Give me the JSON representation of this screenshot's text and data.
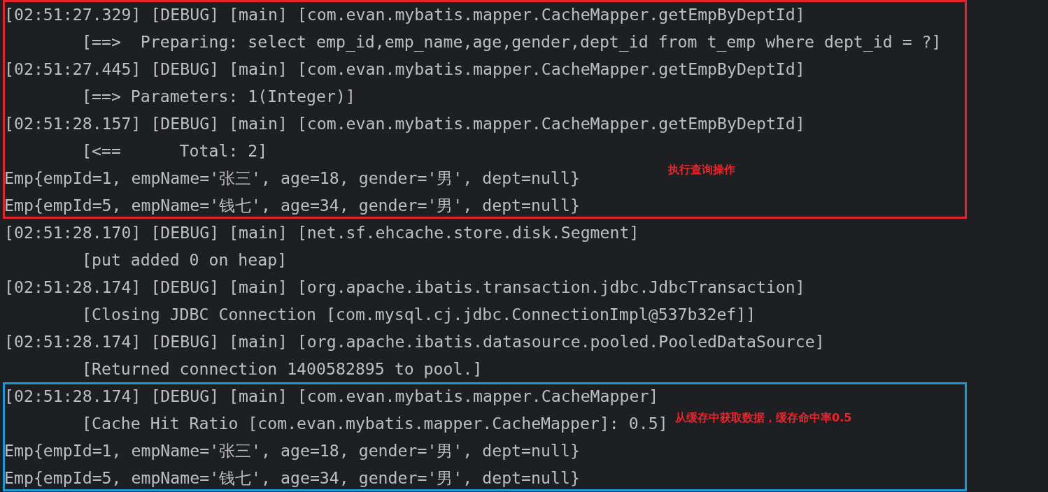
{
  "blocks": [
    {
      "kind": "boxed",
      "color": "#e5232a",
      "note": "执行查询操作",
      "lines": [
        {
          "kind": "header",
          "text": "[02:51:27.329] [DEBUG] [main] [com.evan.mybatis.mapper.CacheMapper.getEmpByDeptId]"
        },
        {
          "kind": "detail",
          "text": "[==>  Preparing: select emp_id,emp_name,age,gender,dept_id from t_emp where dept_id = ?]"
        },
        {
          "kind": "header",
          "text": "[02:51:27.445] [DEBUG] [main] [com.evan.mybatis.mapper.CacheMapper.getEmpByDeptId]"
        },
        {
          "kind": "detail",
          "text": "[==> Parameters: 1(Integer)]"
        },
        {
          "kind": "header",
          "text": "[02:51:28.157] [DEBUG] [main] [com.evan.mybatis.mapper.CacheMapper.getEmpByDeptId]"
        },
        {
          "kind": "detail",
          "text": "[<==      Total: 2]"
        },
        {
          "kind": "header",
          "text": "Emp{empId=1, empName='张三', age=18, gender='男', dept=null}"
        },
        {
          "kind": "header",
          "text": "Emp{empId=5, empName='钱七', age=34, gender='男', dept=null}"
        }
      ]
    },
    {
      "kind": "plain",
      "lines": [
        {
          "kind": "header",
          "text": "[02:51:28.170] [DEBUG] [main] [net.sf.ehcache.store.disk.Segment]"
        },
        {
          "kind": "detail",
          "text": "[put added 0 on heap]"
        },
        {
          "kind": "header",
          "text": "[02:51:28.174] [DEBUG] [main] [org.apache.ibatis.transaction.jdbc.JdbcTransaction]"
        },
        {
          "kind": "detail",
          "text": "[Closing JDBC Connection [com.mysql.cj.jdbc.ConnectionImpl@537b32ef]]"
        },
        {
          "kind": "header",
          "text": "[02:51:28.174] [DEBUG] [main] [org.apache.ibatis.datasource.pooled.PooledDataSource]"
        },
        {
          "kind": "detail",
          "text": "[Returned connection 1400582895 to pool.]"
        }
      ]
    },
    {
      "kind": "boxed",
      "color": "#1a9bd8",
      "note": "从缓存中获取数据，缓存命中率0.5",
      "lines": [
        {
          "kind": "header",
          "text": "[02:51:28.174] [DEBUG] [main] [com.evan.mybatis.mapper.CacheMapper]"
        },
        {
          "kind": "detail",
          "text": "[Cache Hit Ratio [com.evan.mybatis.mapper.CacheMapper]: 0.5]"
        },
        {
          "kind": "header",
          "text": "Emp{empId=1, empName='张三', age=18, gender='男', dept=null}"
        },
        {
          "kind": "header",
          "text": "Emp{empId=5, empName='钱七', age=34, gender='男', dept=null}"
        }
      ]
    }
  ]
}
